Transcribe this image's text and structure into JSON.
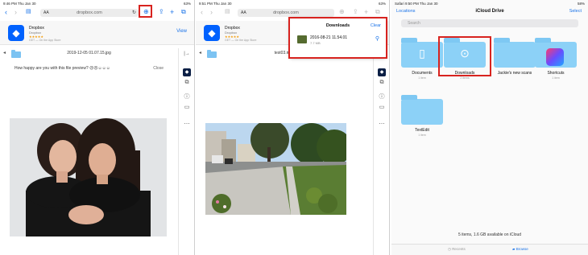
{
  "colors": {
    "accent": "#1a73e8",
    "highlight": "#d8231f",
    "folder": "#8cd1f7",
    "dropbox": "#0061fe"
  },
  "panel1": {
    "status": {
      "time": "9:46 PM  Thu Jan 30",
      "battery": "63%"
    },
    "url": "dropbox.com",
    "aa": "AA",
    "banner": {
      "app_name": "Dropbox",
      "developer": "Dropbox",
      "rating": "★★★★★",
      "get": "GET — On the App Store",
      "view": "View"
    },
    "file_name": "2019-12-05 01.07.15.jpg",
    "feedback": "How happy are you with this file preview? ☹☹☺☺☺",
    "close": "Close"
  },
  "panel2": {
    "status": {
      "time": "9:51 PM  Thu Jan 30",
      "battery": "63%"
    },
    "url": "dropbox.com",
    "aa": "AA",
    "banner": {
      "app_name": "Dropbox",
      "developer": "Dropbox",
      "rating": "★★★★★",
      "get": "GET — On the App Store",
      "view": "View"
    },
    "file_name": "test03.mp4",
    "downloads": {
      "title": "Downloads",
      "clear": "Clear",
      "item_name": "2016-08-21 11.54.01",
      "item_size": "7.7 MB"
    }
  },
  "panel3": {
    "status": {
      "time": "Safari  9:50 PM  Thu Jan 30",
      "battery": "58%"
    },
    "locations": "Locations",
    "title": "iCloud Drive",
    "select": "Select",
    "search_placeholder": "Search",
    "folders": [
      {
        "label": "Documents",
        "meta": "1 item",
        "glyph": "doc-icon"
      },
      {
        "label": "Downloads",
        "meta": "2 items",
        "glyph": "download-icon"
      },
      {
        "label": "Jackie's new scans",
        "meta": "",
        "glyph": ""
      },
      {
        "label": "Shortcuts",
        "meta": "1 item",
        "glyph": "shortcuts-app-icon"
      },
      {
        "label": "TextEdit",
        "meta": "1 item",
        "glyph": ""
      }
    ],
    "footer": "5 items, 1.6 GB available on iCloud",
    "tabs": {
      "recents": "Recents",
      "browse": "Browse"
    }
  }
}
